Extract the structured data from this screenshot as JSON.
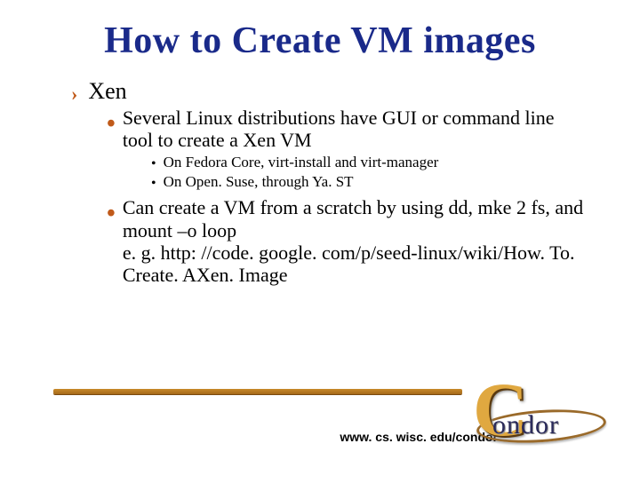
{
  "title": "How to Create VM images",
  "bullets": {
    "l1": "Xen",
    "l2a": "Several Linux distributions have GUI or command line tool to create a Xen VM",
    "l3a": "On Fedora Core, virt-install and virt-manager",
    "l3b": "On Open. Suse, through Ya. ST",
    "l2b": "Can create a VM from a scratch by using dd, mke 2 fs, and mount –o loop\ne. g. http: //code. google. com/p/seed-linux/wiki/How. To. Create. AXen. Image"
  },
  "footer_url": "www. cs. wisc. edu/condor",
  "logo": {
    "big_c": "C",
    "word": "ondor"
  }
}
